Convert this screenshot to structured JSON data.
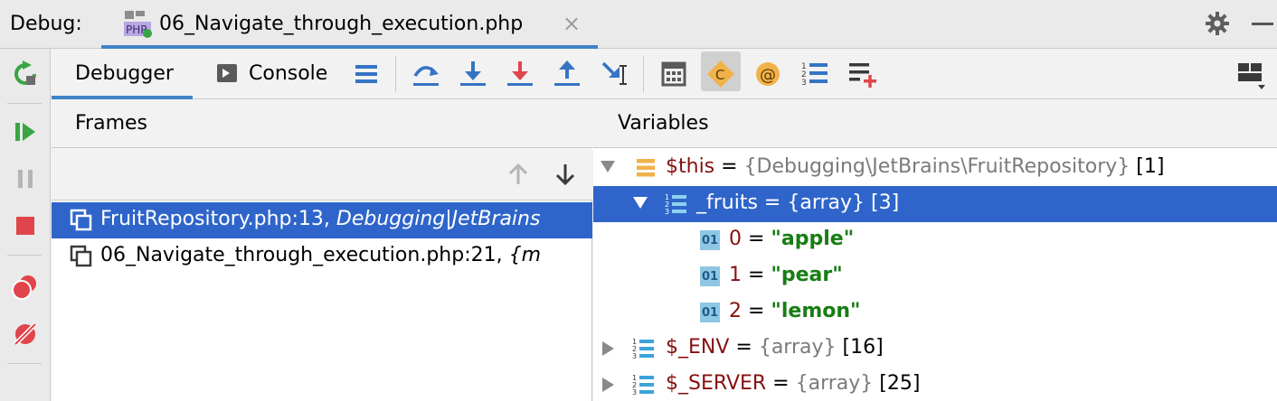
{
  "titlebar": {
    "label": "Debug:",
    "run_tab_title": "06_Navigate_through_execution.php",
    "close_glyph": "×",
    "icons": [
      "php-file-icon",
      "close-icon",
      "gear-icon",
      "minimize-icon"
    ]
  },
  "left_toolbar": {
    "icons": [
      "rerun-icon",
      "resume-icon",
      "pause-icon",
      "stop-icon",
      "view-breakpoints-icon",
      "mute-breakpoints-icon"
    ]
  },
  "debugger_toolbar": {
    "tabs": [
      {
        "label": "Debugger",
        "active": true
      },
      {
        "label": "Console",
        "active": false
      }
    ],
    "icons": [
      "show-execution-point-icon",
      "step-over-icon",
      "step-into-icon",
      "force-step-into-icon",
      "step-out-icon",
      "run-to-cursor-icon",
      "evaluate-expression-icon",
      "class-constants-icon",
      "magic-constants-icon",
      "array-icon",
      "add-watch-icon",
      "layout-icon"
    ],
    "active_icon": "class-constants-icon",
    "class_icon_letter": "C",
    "magic_icon_letter": "@"
  },
  "frames": {
    "header": "Frames",
    "rows": [
      {
        "location": "FruitRepository.php:13,",
        "context": "Debugging|JetBrains",
        "selected": true
      },
      {
        "location": "06_Navigate_through_execution.php:21,",
        "context": "{m",
        "selected": false
      }
    ]
  },
  "variables": {
    "header": "Variables",
    "rows": [
      {
        "name": "$this",
        "eq": " = ",
        "type": "{Debugging\\JetBrains\\FruitRepository}",
        "extra": " [1]",
        "expanded": true,
        "icon": "object-field-icon",
        "selected": false
      },
      {
        "name": "_fruits",
        "eq": " = ",
        "type": "{array}",
        "extra": " [3]",
        "expanded": true,
        "icon": "array-icon",
        "selected": true
      },
      {
        "name": "0",
        "eq": " = ",
        "value": "\"apple\"",
        "icon": "primitive-icon",
        "icon_label": "01"
      },
      {
        "name": "1",
        "eq": " = ",
        "value": "\"pear\"",
        "icon": "primitive-icon",
        "icon_label": "01"
      },
      {
        "name": "2",
        "eq": " = ",
        "value": "\"lemon\"",
        "icon": "primitive-icon",
        "icon_label": "01"
      },
      {
        "name": "$_ENV",
        "eq": " = ",
        "type": "{array}",
        "extra": " [16]",
        "expanded": false,
        "icon": "array-icon"
      },
      {
        "name": "$_SERVER",
        "eq": " = ",
        "type": "{array}",
        "extra": " [25]",
        "expanded": false,
        "icon": "array-icon"
      }
    ]
  },
  "colors": {
    "accent": "#4083c9",
    "selection": "#2f65ca",
    "var_name": "#871010",
    "string_value": "#187d14",
    "type_text": "#7a7a7a"
  }
}
